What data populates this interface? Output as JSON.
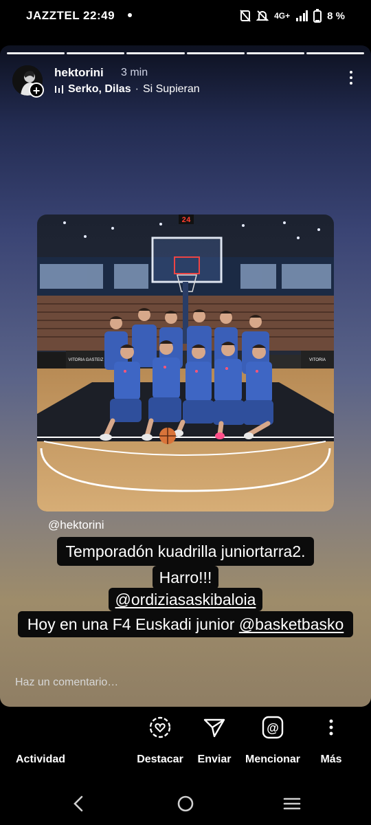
{
  "status_bar": {
    "carrier": "JAZZTEL",
    "time": "22:49",
    "network": "4G+",
    "battery": "8 %"
  },
  "story": {
    "username": "hektorini",
    "posted_ago": "3 min",
    "music_artist": "Serko, Dilas",
    "music_separator": "·",
    "music_title": "Si Supieran",
    "progress_segments": 6,
    "photo_scoreboard": "24",
    "photo_banner_left": "VITORIA GASTEIZ",
    "photo_banner_right": "VITORIA",
    "mention_tag": "@hektorini",
    "caption": {
      "line1": "Temporadón kuadrilla juniortarra2.",
      "line2": "Harro!!!",
      "line3": "@ordiziasaskibaloia",
      "line4_text": "Hoy en una F4 Euskadi junior ",
      "line4_mention": "@basketbasko"
    },
    "comment_placeholder": "Haz un comentario…"
  },
  "actions": {
    "activity": "Actividad",
    "highlight": "Destacar",
    "send": "Enviar",
    "mention": "Mencionar",
    "more": "Más"
  },
  "colors": {
    "background": "#000000",
    "caption_box": "#0b0b0b",
    "court_wood": "#c49a62",
    "jersey_blue": "#3a5fb8"
  }
}
